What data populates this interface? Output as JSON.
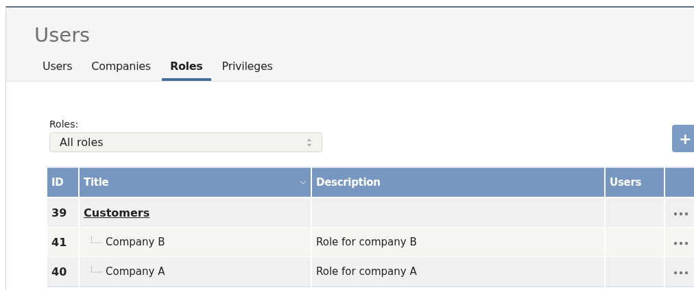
{
  "page": {
    "title": "Users"
  },
  "tabs": [
    {
      "label": "Users",
      "selected": false
    },
    {
      "label": "Companies",
      "selected": false
    },
    {
      "label": "Roles",
      "selected": true
    },
    {
      "label": "Privileges",
      "selected": false
    }
  ],
  "filter": {
    "label": "Roles:",
    "value": "All roles"
  },
  "add_button": "+",
  "table": {
    "columns": [
      {
        "label": "ID",
        "sorted": false
      },
      {
        "label": "Title",
        "sorted": true
      },
      {
        "label": "Description",
        "sorted": false
      },
      {
        "label": "Users",
        "sorted": false
      },
      {
        "sorted": false
      }
    ],
    "rows": [
      {
        "id": "39",
        "title": "Customers",
        "children": [
          {
            "id": "41",
            "title": "Company B",
            "description": "Role for company B"
          },
          {
            "id": "40",
            "title": "Company A",
            "description": "Role for company A"
          }
        ]
      }
    ]
  }
}
